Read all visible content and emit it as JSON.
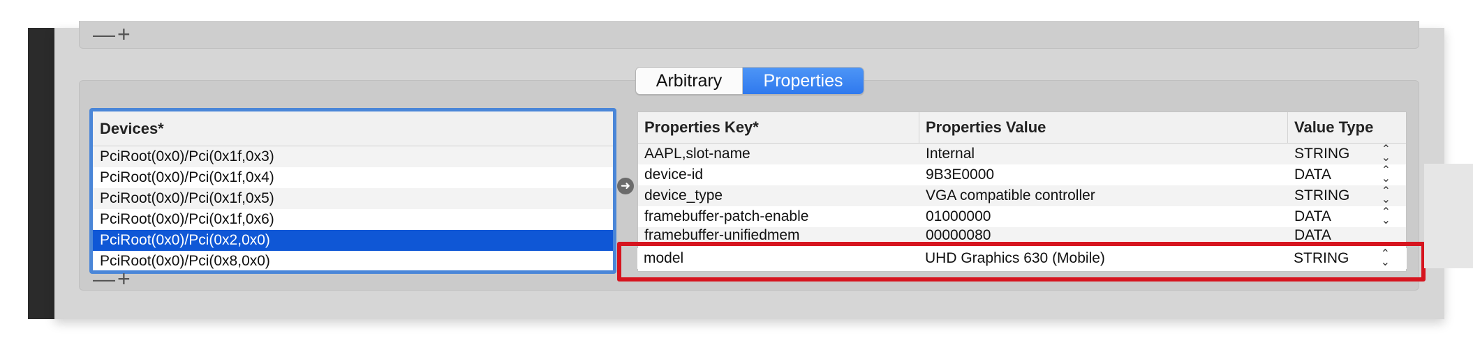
{
  "top_panel": {
    "remove_label": "—",
    "add_label": "+"
  },
  "tabs": [
    {
      "label": "Arbitrary"
    },
    {
      "label": "Properties"
    }
  ],
  "devices": {
    "header": "Devices*",
    "rows": [
      "PciRoot(0x0)/Pci(0x1f,0x3)",
      "PciRoot(0x0)/Pci(0x1f,0x4)",
      "PciRoot(0x0)/Pci(0x1f,0x5)",
      "PciRoot(0x0)/Pci(0x1f,0x6)",
      "PciRoot(0x0)/Pci(0x2,0x0)",
      "PciRoot(0x0)/Pci(0x8,0x0)"
    ],
    "selected_index": 4,
    "remove_label": "—",
    "add_label": "+"
  },
  "properties": {
    "headers": {
      "key": "Properties Key*",
      "value": "Properties Value",
      "type": "Value Type"
    },
    "rows": [
      {
        "key": "AAPL,slot-name",
        "value": "Internal",
        "type": "STRING"
      },
      {
        "key": "device-id",
        "value": "9B3E0000",
        "type": "DATA"
      },
      {
        "key": "device_type",
        "value": "VGA compatible controller",
        "type": "STRING"
      },
      {
        "key": "framebuffer-patch-enable",
        "value": "01000000",
        "type": "DATA"
      },
      {
        "key": "framebuffer-unifiedmem",
        "value": "00000080",
        "type": "DATA"
      },
      {
        "key": "model",
        "value": "UHD Graphics 630 (Mobile)",
        "type": "STRING"
      }
    ],
    "stepper_icon": "updown-chevron-icon"
  },
  "colors": {
    "highlight_border": "#d6141e",
    "selection": "#0f57d6",
    "accent": "#2f79ee"
  }
}
